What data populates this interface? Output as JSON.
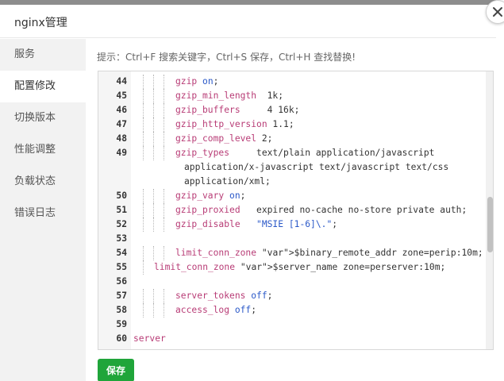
{
  "dialog": {
    "title": "nginx管理"
  },
  "sidebar": {
    "items": [
      {
        "label": "服务",
        "active": false
      },
      {
        "label": "配置修改",
        "active": true
      },
      {
        "label": "切换版本",
        "active": false
      },
      {
        "label": "性能调整",
        "active": false
      },
      {
        "label": "负载状态",
        "active": false
      },
      {
        "label": "错误日志",
        "active": false
      }
    ]
  },
  "hint": "提示：Ctrl+F 搜索关键字，Ctrl+S 保存，Ctrl+H 查找替换!",
  "editor": {
    "lines": [
      {
        "no": "44",
        "code": "gzip on;"
      },
      {
        "no": "45",
        "code": "gzip_min_length  1k;"
      },
      {
        "no": "46",
        "code": "gzip_buffers     4 16k;"
      },
      {
        "no": "47",
        "code": "gzip_http_version 1.1;"
      },
      {
        "no": "48",
        "code": "gzip_comp_level 2;"
      },
      {
        "no": "49",
        "code": "gzip_types     text/plain application/javascript"
      },
      {
        "no": "",
        "code": "application/x-javascript text/javascript text/css"
      },
      {
        "no": "",
        "code": "application/xml;"
      },
      {
        "no": "50",
        "code": "gzip_vary on;"
      },
      {
        "no": "51",
        "code": "gzip_proxied   expired no-cache no-store private auth;"
      },
      {
        "no": "52",
        "code": "gzip_disable   \"MSIE [1-6]\\.\";"
      },
      {
        "no": "53",
        "code": ""
      },
      {
        "no": "54",
        "code": "limit_conn_zone $binary_remote_addr zone=perip:10m;"
      },
      {
        "no": "55",
        "code": "limit_conn_zone $server_name zone=perserver:10m;"
      },
      {
        "no": "56",
        "code": ""
      },
      {
        "no": "57",
        "code": "server_tokens off;"
      },
      {
        "no": "58",
        "code": "access_log off;"
      },
      {
        "no": "59",
        "code": ""
      },
      {
        "no": "60",
        "code": "server"
      }
    ]
  },
  "save_button": "保存",
  "colors": {
    "accent": "#20a53a",
    "keyword": "#b83c76",
    "value": "#2a58c8",
    "variable": "#1f7a78"
  }
}
